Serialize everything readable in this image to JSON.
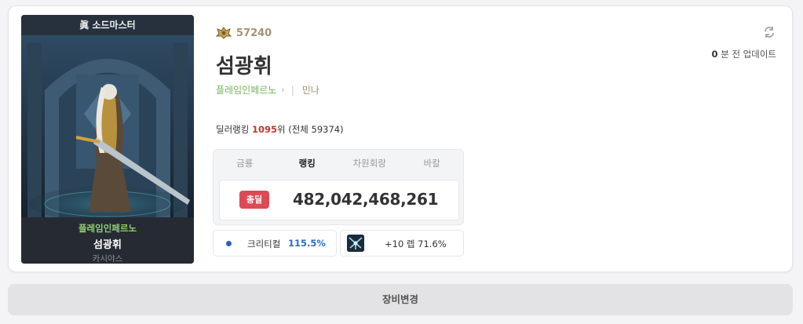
{
  "character": {
    "job_title": "眞 소드마스터",
    "guild": "플레임인페르노",
    "name": "섬광휘",
    "server": "카시야스"
  },
  "fame": {
    "value": "57240",
    "icon": "fame-crest-icon"
  },
  "header": {
    "name": "섬광휘",
    "adventure_label": "플레임인페르노",
    "adventure_name": "민나",
    "update_prefix": "0",
    "update_suffix": " 분 전 업데이트"
  },
  "rank": {
    "prefix": "딜러랭킹 ",
    "position": "1095",
    "suffix": "위 (전체 59374)"
  },
  "tabs": [
    {
      "label": "금룡"
    },
    {
      "label": "랭킹"
    },
    {
      "label": "차원회랑"
    },
    {
      "label": "바칼"
    }
  ],
  "damage": {
    "badge": "총딜",
    "value": "482,042,468,261"
  },
  "critical": {
    "label": "크리티컬",
    "value": "115.5%"
  },
  "enhancement": {
    "text": "+10 렙 71.6%"
  },
  "equip_button": "장비변경",
  "colors": {
    "accent_red": "#dc4b55",
    "guild_green": "#76b25a",
    "fame_gold": "#a69274",
    "crit_blue": "#2a6cc4"
  }
}
